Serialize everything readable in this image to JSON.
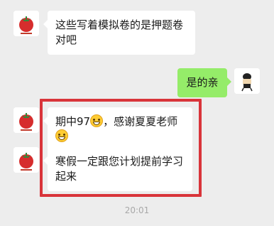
{
  "messages": [
    {
      "side": "left",
      "text": "这些写着模拟卷的是押题卷对吧"
    },
    {
      "side": "right",
      "text": "是的亲"
    },
    {
      "side": "left",
      "text_a": "期中97",
      "emoji": "grinning-emoji",
      "text_b": "，感谢夏夏老师"
    },
    {
      "side": "left",
      "text": "寒假一定跟您计划提前学习起来"
    }
  ],
  "timestamp": "20:01",
  "colors": {
    "background": "#ededed",
    "bubble_left": "#ffffff",
    "bubble_right": "#95ec69",
    "highlight_border": "#d9343a"
  },
  "icons": {
    "left_avatar": "tomato-logo-avatar",
    "right_avatar": "cartoon-figure-avatar"
  }
}
